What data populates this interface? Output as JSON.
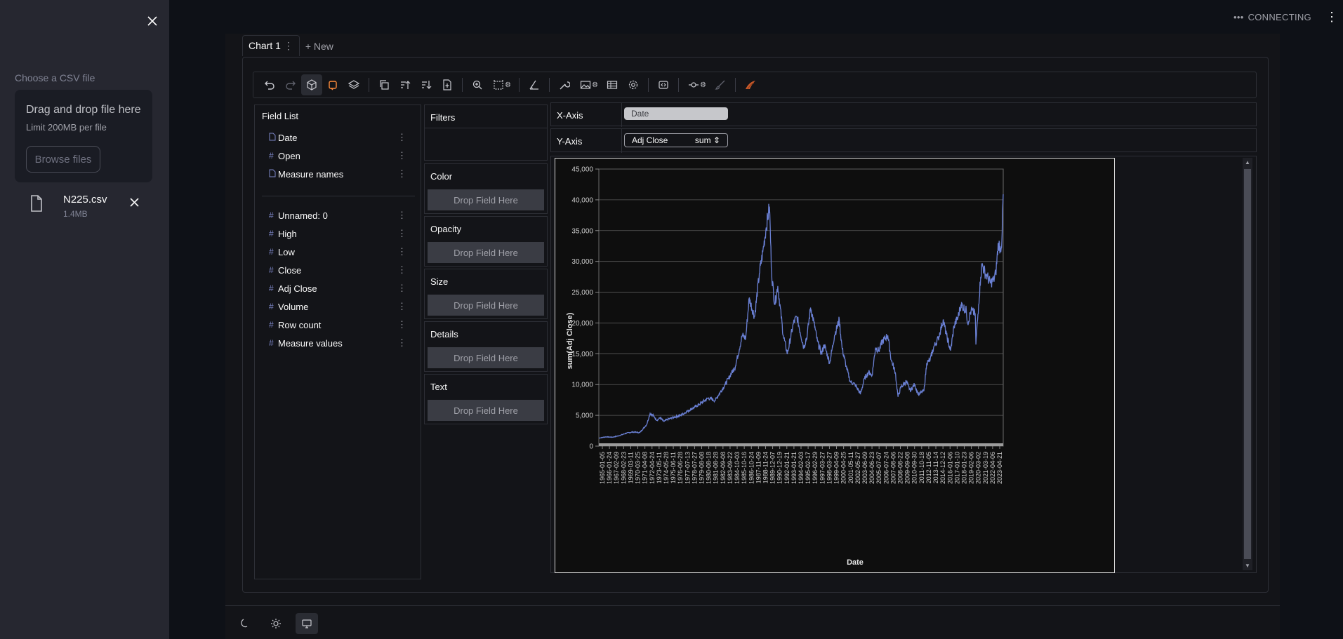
{
  "header": {
    "status": "CONNECTING",
    "menu_icon": "kebab-vertical-icon"
  },
  "sidebar": {
    "close_icon": "close-icon",
    "upload_label": "Choose a CSV file",
    "dropzone": {
      "title": "Drag and drop file here",
      "limit": "Limit 200MB per file",
      "browse_label": "Browse files"
    },
    "file": {
      "name": "N225.csv",
      "size": "1.4MB"
    }
  },
  "tabs": [
    {
      "label": "Chart 1"
    },
    {
      "label": "+ New"
    }
  ],
  "field_list": {
    "title": "Field List",
    "dimensions": [
      {
        "icon": "text-field-icon",
        "label": "Date"
      },
      {
        "icon": "hash",
        "label": "Open"
      },
      {
        "icon": "text-field-icon",
        "label": "Measure names"
      }
    ],
    "measures": [
      {
        "icon": "hash",
        "label": "Unnamed: 0"
      },
      {
        "icon": "hash",
        "label": "High"
      },
      {
        "icon": "hash",
        "label": "Low"
      },
      {
        "icon": "hash",
        "label": "Close"
      },
      {
        "icon": "hash",
        "label": "Adj Close"
      },
      {
        "icon": "hash",
        "label": "Volume"
      },
      {
        "icon": "hash",
        "label": "Row count"
      },
      {
        "icon": "hash",
        "label": "Measure values"
      }
    ]
  },
  "encodings": {
    "filters": "Filters",
    "color": "Color",
    "opacity": "Opacity",
    "size": "Size",
    "details": "Details",
    "text": "Text",
    "drop_label": "Drop Field Here"
  },
  "axes": {
    "x_label": "X-Axis",
    "x_field": "Date",
    "y_label": "Y-Axis",
    "y_field": "Adj Close",
    "y_agg": "sum"
  },
  "colors": {
    "accent": "#ff4b4b",
    "line": "#6a80d4",
    "background": "#0e1117"
  },
  "chart_data": {
    "type": "line",
    "xlabel": "Date",
    "ylabel": "sum(Adj Close)",
    "ylim": [
      0,
      45000
    ],
    "y_ticks": [
      "0",
      "5,000",
      "10,000",
      "15,000",
      "20,000",
      "25,000",
      "30,000",
      "35,000",
      "40,000",
      "45,000"
    ],
    "x_ticks": [
      "1965-01-05",
      "1966-01-24",
      "1967-02-09",
      "1968-02-23",
      "1969-03-11",
      "1970-03-25",
      "1971-04-08",
      "1972-04-24",
      "1973-05-11",
      "1974-05-28",
      "1975-06-11",
      "1976-06-28",
      "1977-07-13",
      "1978-07-27",
      "1979-08-08",
      "1980-08-18",
      "1981-08-28",
      "1982-09-08",
      "1983-09-22",
      "1984-10-03",
      "1985-10-16",
      "1986-10-24",
      "1987-11-09",
      "1988-11-24",
      "1989-12-07",
      "1990-12-19",
      "1992-01-21",
      "1993-01-21",
      "1994-02-03",
      "1995-02-17",
      "1996-02-29",
      "1997-03-27",
      "1998-03-27",
      "1999-04-09",
      "2000-04-25",
      "2001-05-11",
      "2002-05-27",
      "2003-06-09",
      "2004-06-23",
      "2005-07-07",
      "2006-07-24",
      "2007-08-06",
      "2008-08-22",
      "2009-09-08",
      "2010-09-30",
      "2011-10-18",
      "2012-11-05",
      "2013-11-14",
      "2014-12-12",
      "2016-01-06",
      "2017-01-10",
      "2018-01-23",
      "2019-02-06",
      "2020-03-02",
      "2021-03-19",
      "2022-04-06",
      "2023-04-21"
    ],
    "series": [
      {
        "x": [
          1965.0,
          1966.0,
          1967.0,
          1968.0,
          1969.0,
          1970.0,
          1971.0,
          1972.0,
          1972.5,
          1973.0,
          1973.5,
          1974.0,
          1974.5,
          1975.0,
          1976.0,
          1977.0,
          1978.0,
          1979.0,
          1980.0,
          1981.0,
          1982.0,
          1982.8,
          1983.5,
          1984.0,
          1985.0,
          1986.0,
          1986.5,
          1987.0,
          1987.8,
          1988.5,
          1989.0,
          1989.5,
          1989.98,
          1990.3,
          1990.75,
          1991.2,
          1992.0,
          1992.6,
          1993.5,
          1994.0,
          1995.0,
          1995.5,
          1996.0,
          1996.5,
          1997.0,
          1997.6,
          1998.0,
          1998.8,
          1999.5,
          2000.2,
          2000.6,
          2001.2,
          2001.8,
          2002.5,
          2003.3,
          2003.9,
          2004.5,
          2005.0,
          2005.5,
          2006.0,
          2006.5,
          2007.3,
          2007.8,
          2008.4,
          2008.8,
          2009.2,
          2010.0,
          2010.6,
          2011.2,
          2011.8,
          2012.6,
          2013.0,
          2013.5,
          2014.0,
          2014.7,
          2015.4,
          2015.9,
          2016.5,
          2017.0,
          2017.6,
          2018.0,
          2018.8,
          2019.0,
          2019.5,
          2020.1,
          2020.2,
          2020.6,
          2020.9,
          2021.1,
          2021.6,
          2021.9,
          2022.3,
          2022.8,
          2023.1,
          2023.5,
          2023.8,
          2024.0,
          2024.2
        ],
        "y": [
          1300,
          1500,
          1450,
          1700,
          2100,
          2300,
          2200,
          3500,
          5300,
          4900,
          4200,
          4600,
          4000,
          4300,
          4700,
          5000,
          5700,
          6300,
          7000,
          7800,
          7400,
          8800,
          10000,
          11000,
          13000,
          18000,
          17500,
          24000,
          21000,
          28000,
          31500,
          35500,
          38900,
          28000,
          23000,
          26000,
          18000,
          15000,
          20000,
          21000,
          16000,
          18000,
          22500,
          20000,
          17000,
          15000,
          16500,
          13500,
          18000,
          20500,
          16000,
          13000,
          10500,
          10000,
          8500,
          11000,
          12000,
          11500,
          16000,
          15500,
          17000,
          18000,
          14000,
          12000,
          8000,
          9500,
          10500,
          9000,
          10000,
          8400,
          9000,
          13500,
          14000,
          16000,
          17500,
          20500,
          18000,
          15500,
          19500,
          21000,
          23000,
          22000,
          20000,
          22000,
          21500,
          16500,
          23000,
          27500,
          29500,
          28000,
          27500,
          26500,
          27000,
          28000,
          33000,
          32000,
          33500,
          40900
        ]
      }
    ]
  }
}
